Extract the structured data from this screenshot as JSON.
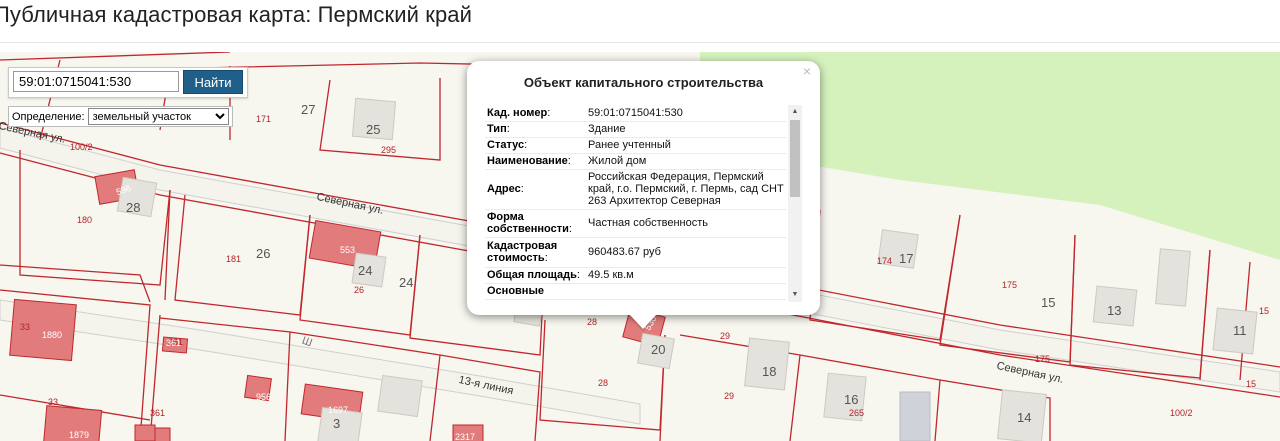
{
  "page": {
    "title": "Публичная кадастровая карта: Пермский край"
  },
  "search": {
    "value": "59:01:0715041:530",
    "button_label": "Найти"
  },
  "definition": {
    "label": "Определение:",
    "selected": "земельный участок"
  },
  "popup": {
    "title": "Объект капитального строительства",
    "close_symbol": "×",
    "rows": [
      {
        "key": "Кад. номер",
        "value": "59:01:0715041:530"
      },
      {
        "key": "Тип",
        "value": "Здание"
      },
      {
        "key": "Статус",
        "value": "Ранее учтенный"
      },
      {
        "key": "Наименование",
        "value": "Жилой дом"
      },
      {
        "key": "Адрес",
        "value": "Российская Федерация, Пермский край, г.о. Пермский, г. Пермь, сад СНТ 263 Архитектор Северная"
      },
      {
        "key": "Форма собственности",
        "value": "Частная собственность"
      },
      {
        "key": "Кадастровая стоимость",
        "value": "960483.67 руб"
      },
      {
        "key": "Общая площадь",
        "value": "49.5 кв.м"
      },
      {
        "key": "Основные",
        "value": ""
      }
    ]
  },
  "map": {
    "streets": [
      "Северная ул.",
      "Северная ул.",
      "13-я линия",
      "Северная ул."
    ],
    "parcel_numbers": [
      "27",
      "25",
      "28",
      "26",
      "24",
      "24",
      "18",
      "17",
      "15",
      "13",
      "11",
      "16",
      "14",
      "3",
      "20"
    ],
    "cadastral_numbers": [
      "171",
      "295",
      "100/2",
      "180",
      "181",
      "26",
      "174",
      "175",
      "175",
      "15",
      "15",
      "29",
      "29",
      "28",
      "28",
      "265",
      "100/2",
      "361",
      "361",
      "33",
      "33"
    ],
    "building_numbers": [
      "596",
      "553",
      "1880",
      "1879",
      "1697",
      "956",
      "361",
      "2317",
      "530"
    ],
    "symbols": [
      "Ш"
    ]
  },
  "colors": {
    "map_background": "#f7f6ef",
    "parcel_border": "#c0272d",
    "building_fill": "#e27c7c",
    "green_area": "#d5f2bd",
    "search_button": "#1f5f8a"
  }
}
